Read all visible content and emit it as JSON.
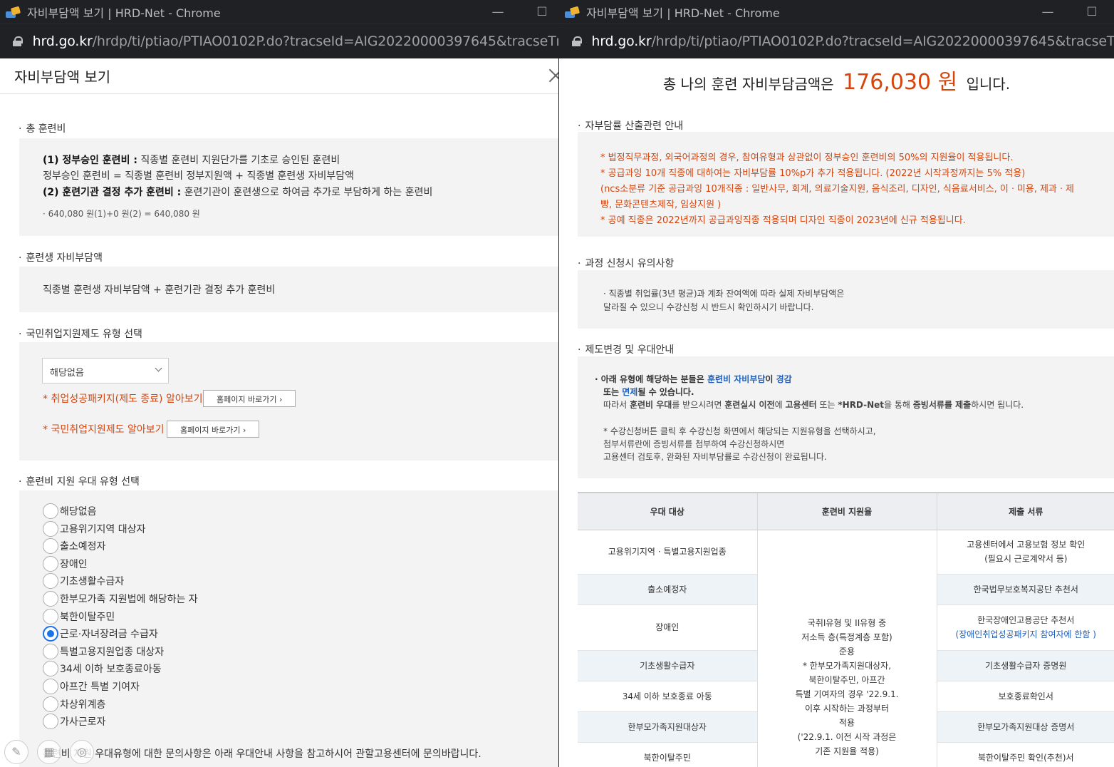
{
  "left_window": {
    "title": "자비부담액 보기 | HRD-Net - Chrome",
    "url_host": "hrd.go.kr",
    "url_path": "/hrdp/ti/ptiao/PTIAO0102P.do?tracseId=AIG20220000397645&tracseTm...",
    "modal_title": "자비부담액 보기",
    "sections": {
      "total_fee": {
        "title": "총 훈련비",
        "line1_bold": "(1) 정부승인 훈련비 :",
        "line1_rest": " 직종별 훈련비 지원단가를 기초로 승인된 훈련비",
        "line2": "정부승인 훈련비 = 직종별 훈련비 정부지원액 + 직종별 훈련생 자비부담액",
        "line3_bold": "(2) 훈련기관 결정 추가 훈련비 :",
        "line3_rest": " 훈련기관이 훈련생으로 하여금 추가로 부담하게 하는 훈련비",
        "calc": "640,080 원(1)+0 원(2) = 640,080 원"
      },
      "trainee_share": {
        "title": "훈련생 자비부담액",
        "formula": "직종별 훈련생 자비부담액 + 훈련기관 결정 추가 훈련비"
      },
      "employment_support": {
        "title": "국민취업지원제도 유형 선택",
        "select_value": "해당없음",
        "link1_text": "* 취업성공패키지(제도 종료) 알아보기",
        "link2_text": "* 국민취업지원제도 알아보기",
        "go_button": "홈페이지 바로가기"
      },
      "preference": {
        "title": "훈련비 지원 우대 유형 선택",
        "options": [
          "해당없음",
          "고용위기지역 대상자",
          "출소예정자",
          "장애인",
          "기초생활수급자",
          "한부모가족 지원법에 해당하는 자",
          "북한이탈주민",
          "근로·자녀장려금 수급자",
          "특별고용지원업종 대상자",
          "34세 이하 보호종료아동",
          "아프간 특별 기여자",
          "차상위계층",
          "가사근로자"
        ],
        "selected_index": 7,
        "footer_note": "훈련비 지원 우대유형에 대한 문의사항은 아래 우대안내 사항을 참고하시어 관할고용센터에 문의바랍니다."
      }
    }
  },
  "right_window": {
    "title": "자비부담액 보기 | HRD-Net - Chrome",
    "url_host": "hrd.go.kr",
    "url_path": "/hrdp/ti/ptiao/PTIAO0102P.do?tracseId=AIG20220000397645&tracseTm...",
    "total_prefix": "총 나의 훈련 자비부담금액은",
    "total_amount": "176,030 원",
    "total_suffix": "입니다.",
    "rate_section": {
      "title": "자부담률 산출관련 안내",
      "lines": [
        "* 법정직무과정, 외국어과정의 경우, 참여유형과 상관없이 정부승인 훈련비의 50%의 지원율이 적용됩니다.",
        "* 공급과잉 10개 직종에 대하여는 자비부담률 10%p가 추가 적용됩니다. (2022년 시작과정까지는 5% 적용)",
        "(ncs소분류 기준 공급과잉 10개직종 : 일반사무, 회계, 의료기술지원, 음식조리, 디자인, 식음료서비스, 이ㆍ미용, 제과ㆍ제",
        "빵, 문화콘텐츠제작, 임상지원 )",
        "* 공예 직종은 2022년까지 공급과잉직종 적용되며 디자인 직종이 2023년에 신규 적용됩니다."
      ]
    },
    "caution_section": {
      "title": "과정 신청시 유의사항",
      "lines": [
        "· 직종별 취업률(3년 평균)과 계좌 잔여액에 따라 실제 자비부담액은",
        "  달라질 수 있으니 수강신청 시 반드시 확인하시기 바랍니다."
      ]
    },
    "policy_section": {
      "title": "제도변경 및 우대안내",
      "l1_a": "· 아래 유형에 해당하는 분들은 ",
      "l1_b": "훈련비 자비부담",
      "l1_c": "이 ",
      "l1_d": "경감",
      "l2_a": "또는 ",
      "l2_b": "면제",
      "l2_c": "될 수 있습니다.",
      "l3_a": "따라서 ",
      "l3_b": "훈련비 우대",
      "l3_c": "를 받으시려면 ",
      "l3_d": "훈련실시 이전",
      "l3_e": "에 ",
      "l3_f": "고용센터",
      "l3_g": " 또는 ",
      "l3_h": "*HRD-Net",
      "l3_i": "을 통해 ",
      "l3_j": "증빙서류를 제출",
      "l3_k": "하시면 됩니다.",
      "l4": "* 수강신청버튼 클릭 후 수강신청 화면에서 해당되는 지원유형을 선택하시고,",
      "l5": "첨부서류란에 증빙서류를 첨부하여 수강신청하시면",
      "l6": "고용센터 검토후, 완화된 자비부담률로 수강신청이 완료됩니다."
    },
    "table": {
      "headers": [
        "우대 대상",
        "훈련비 지원율",
        "제출 서류"
      ],
      "rows": [
        {
          "target": "고용위기지역 · 특별고용지원업종",
          "docs": "고용센터에서 고용보험 정보 확인",
          "docs2": "(필요시 근로계약서 등)"
        },
        {
          "target": "출소예정자",
          "docs": "한국법무보호복지공단 추천서",
          "docs2": ""
        },
        {
          "target": "장애인",
          "docs": "한국장애인고용공단 추천서",
          "docs2": "(장애인취업성공패키지 참여자에 한함 )"
        },
        {
          "target": "기초생활수급자",
          "docs": "기초생활수급자 증명원",
          "docs2": ""
        },
        {
          "target": "34세 이하 보호종료 아동",
          "docs": "보호종료확인서",
          "docs2": ""
        },
        {
          "target": "한부모가족지원대상자",
          "docs": "한부모가족지원대상 증명서",
          "docs2": ""
        },
        {
          "target": "북한이탈주민",
          "docs": "북한이탈주민 확인(추천)서",
          "docs2": ""
        }
      ],
      "support_lines": [
        "국취I유형 및 II유형 중",
        "저소득 층(특정계층 포함)",
        "준용",
        "* 한부모가족지원대상자,",
        "북한이탈주민, 아프간",
        "특별 기여자의 경우 '22.9.1.",
        "이후 시작하는 과정부터",
        "적용",
        "('22.9.1. 이전 시작 과정은",
        "기존 지원율 적용)"
      ]
    }
  }
}
